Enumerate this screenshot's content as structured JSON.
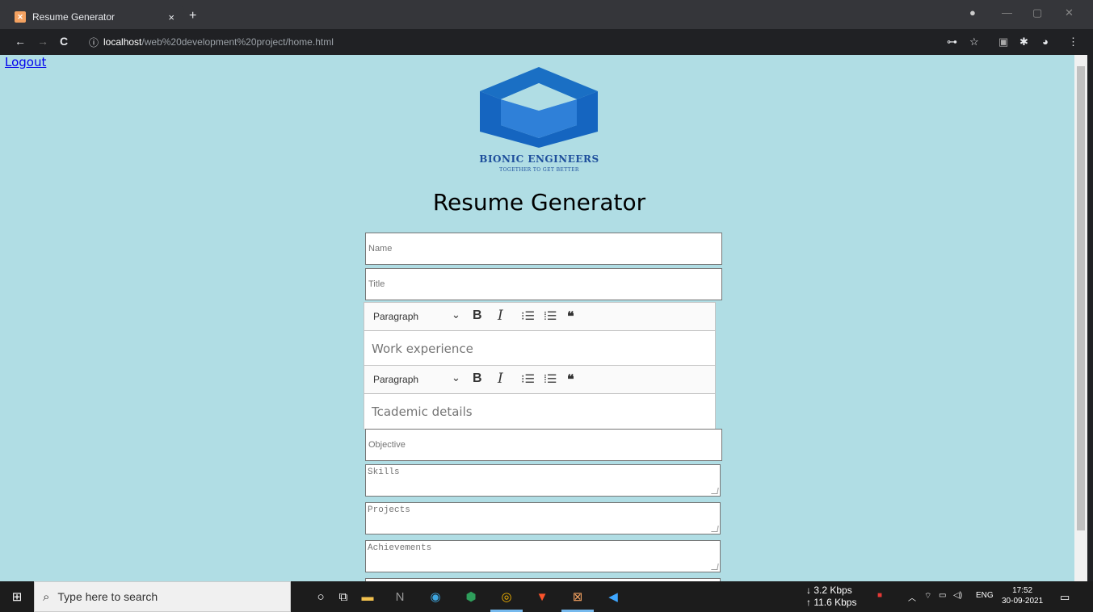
{
  "browser": {
    "tab_title": "Resume Generator",
    "tab_close": "×",
    "new_tab": "+",
    "url_host": "localhost",
    "url_path": "/web%20development%20project/home.html",
    "back": "←",
    "forward": "→",
    "reload": "C",
    "info": "ⓘ"
  },
  "page": {
    "logout": "Logout",
    "brand": "BIONIC ENGINEERS",
    "tagline": "TOGETHER TO GET BETTER",
    "heading": "Resume Generator",
    "fields": {
      "name": "Name",
      "title": "Title",
      "objective": "Objective"
    },
    "editors": [
      {
        "format": "Paragraph",
        "placeholder": "Work experience"
      },
      {
        "format": "Paragraph",
        "placeholder": "Tcademic details"
      }
    ],
    "textareas": {
      "skills": "Skills",
      "projects": "Projects",
      "achievements": "Achievements"
    }
  },
  "taskbar": {
    "search_placeholder": "Type here to search",
    "net_down": "↓ 3.2 Kbps",
    "net_up": "↑ 11.6 Kbps",
    "lang": "ENG",
    "time": "17:52",
    "date": "30-09-2021"
  },
  "colors": {
    "page_bg": "#b0dde4",
    "brand_blue": "#1e4f9c",
    "logo_blue": "#1a6fc4"
  }
}
